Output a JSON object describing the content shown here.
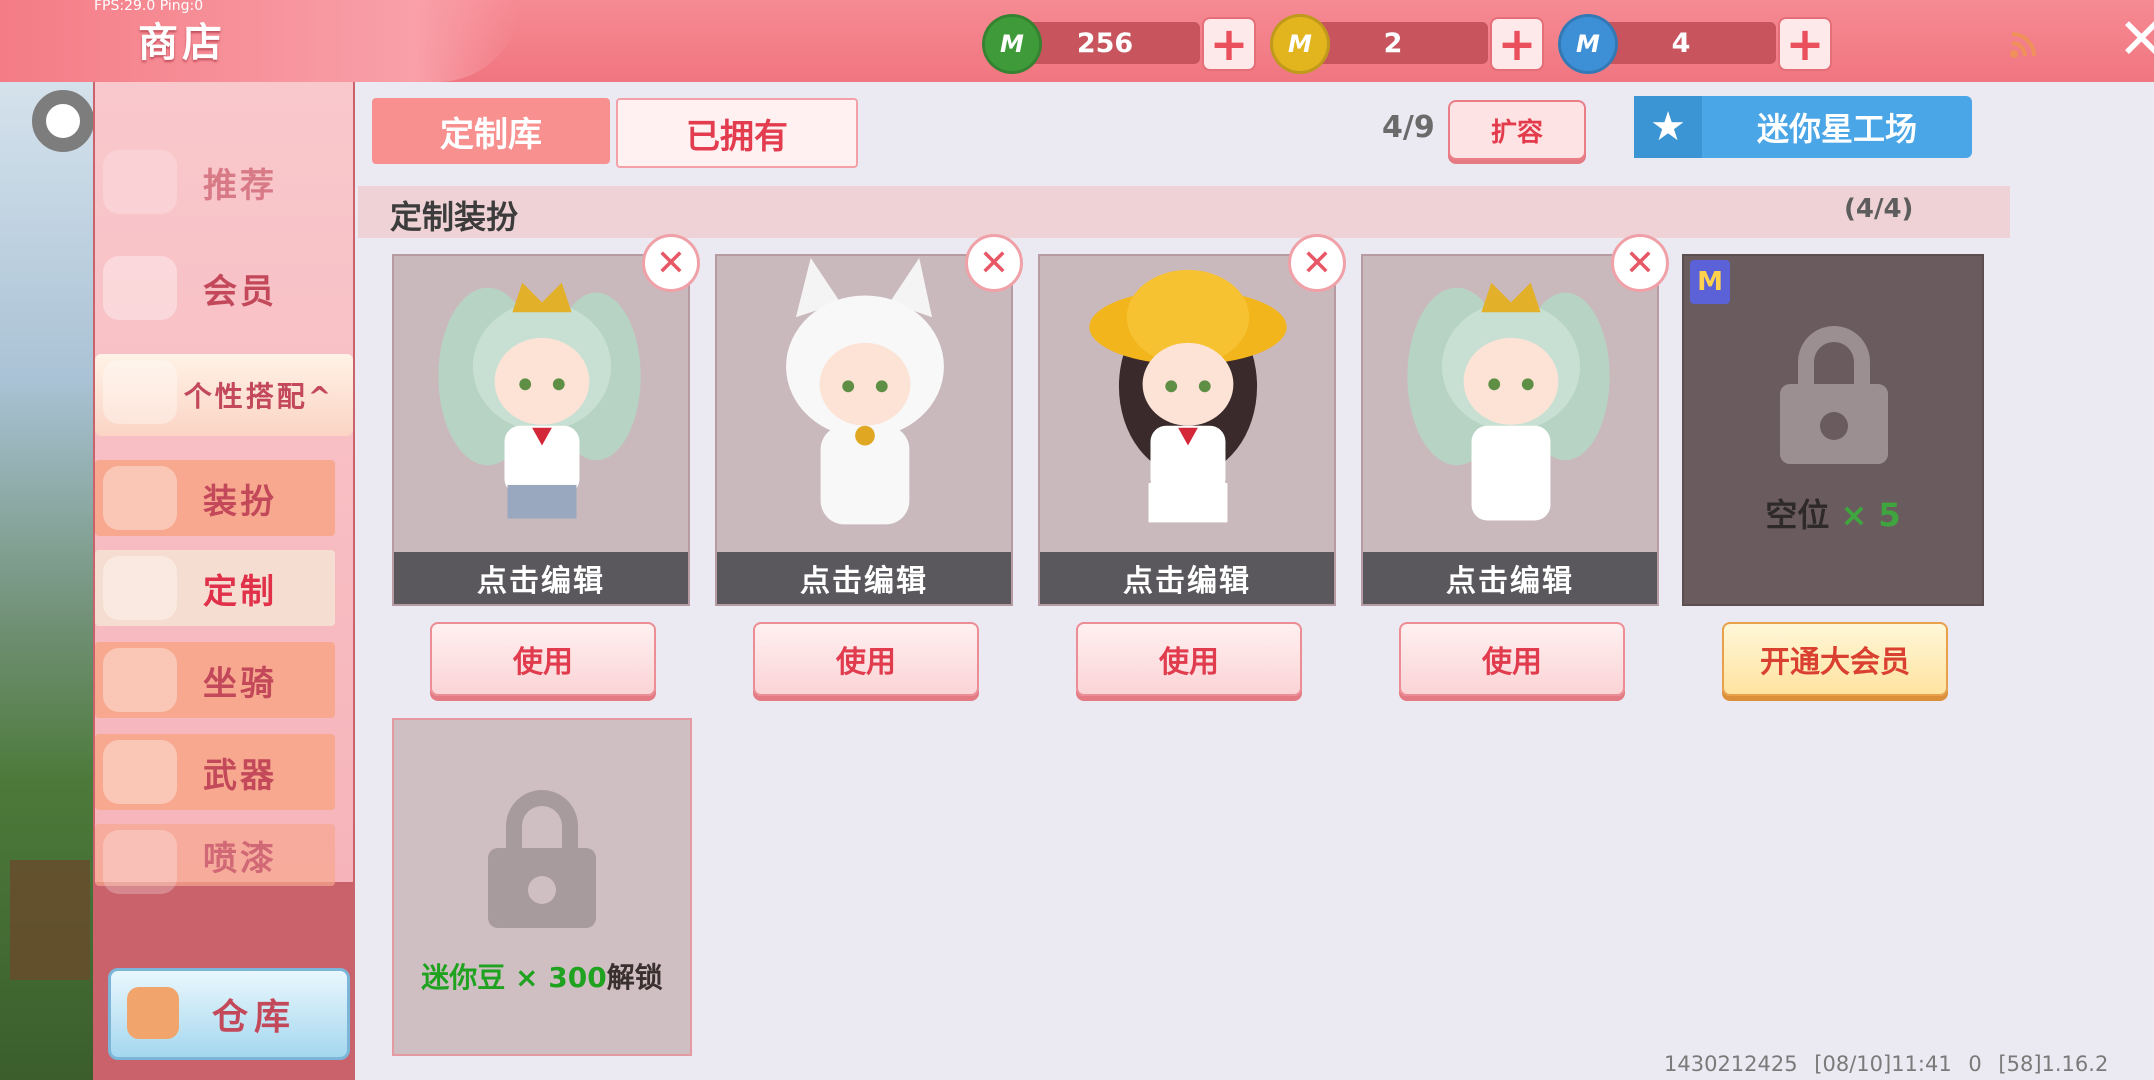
{
  "debug": {
    "fps_ping": "FPS:29.0  Ping:0"
  },
  "header": {
    "title": "商店",
    "close_icon": "close-icon"
  },
  "currencies": [
    {
      "name": "mini-bean",
      "value": "256",
      "color": "#3f9b3a"
    },
    {
      "name": "mini-coin",
      "value": "2",
      "color": "#e2b51f"
    },
    {
      "name": "mini-point",
      "value": "4",
      "color": "#3d8fd6"
    }
  ],
  "sidebar": {
    "items": [
      {
        "label": "推荐"
      },
      {
        "label": "会员"
      },
      {
        "label": "个性搭配^"
      },
      {
        "label": "装扮"
      },
      {
        "label": "定制"
      },
      {
        "label": "坐骑"
      },
      {
        "label": "武器"
      },
      {
        "label": "喷漆"
      }
    ],
    "active": "定制",
    "warehouse_label": "仓库"
  },
  "tabs": [
    {
      "label": "定制库",
      "active": true
    },
    {
      "label": "已拥有",
      "active": false
    }
  ],
  "capacity": {
    "value": "4/9",
    "expand_label": "扩容"
  },
  "mini_star_label": "迷你星工场",
  "section": {
    "title": "定制装扮",
    "count": "(4/4)"
  },
  "cards": [
    {
      "edit_label": "点击编辑",
      "use_label": "使用",
      "outfit": "crown-sailor-skirt",
      "hair": "#b7d3c4"
    },
    {
      "edit_label": "点击编辑",
      "use_label": "使用",
      "outfit": "white-cat-suit",
      "hair": "#ffffff"
    },
    {
      "edit_label": "点击编辑",
      "use_label": "使用",
      "outfit": "yellow-hat-sailor",
      "hair": "#3a2a2c"
    },
    {
      "edit_label": "点击编辑",
      "use_label": "使用",
      "outfit": "crown-white-dress",
      "hair": "#b7d3c4"
    }
  ],
  "vip_slot": {
    "badge": "M",
    "label": "空位",
    "mult": "× 5",
    "button": "开通大会员"
  },
  "locked_slot": {
    "prefix": "迷你豆 × 300",
    "suffix": "解锁"
  },
  "footer": "1430212425    [08/10]11:41 0    [58]1.16.2"
}
